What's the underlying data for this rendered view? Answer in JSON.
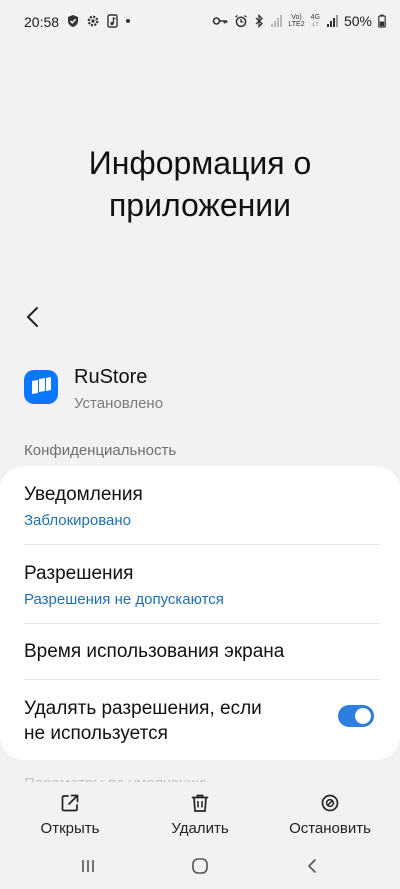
{
  "status_bar": {
    "time": "20:58",
    "battery": "50%",
    "network_top": "Vo)",
    "network_bottom": "LTE2",
    "network_type": "4G"
  },
  "header": {
    "title": "Информация о приложении"
  },
  "app": {
    "name": "RuStore",
    "status": "Установлено"
  },
  "section": {
    "privacy": "Конфиденциальность",
    "defaults": "Параметры по умолчанию"
  },
  "settings": {
    "notifications": {
      "title": "Уведомления",
      "sub": "Заблокировано"
    },
    "permissions": {
      "title": "Разрешения",
      "sub": "Разрешения не допускаются"
    },
    "screen_time": {
      "title": "Время использования экрана"
    },
    "remove_permissions": {
      "title_line1": "Удалять разрешения, если",
      "title_line2": "не используется",
      "enabled": true
    }
  },
  "actions": {
    "open": "Открыть",
    "uninstall": "Удалить",
    "stop": "Остановить"
  },
  "colors": {
    "accent": "#2e7de0",
    "link": "#1f6fb4",
    "app_icon_bg": "#0a77ff",
    "background": "#f2f2f2",
    "card": "#ffffff"
  }
}
